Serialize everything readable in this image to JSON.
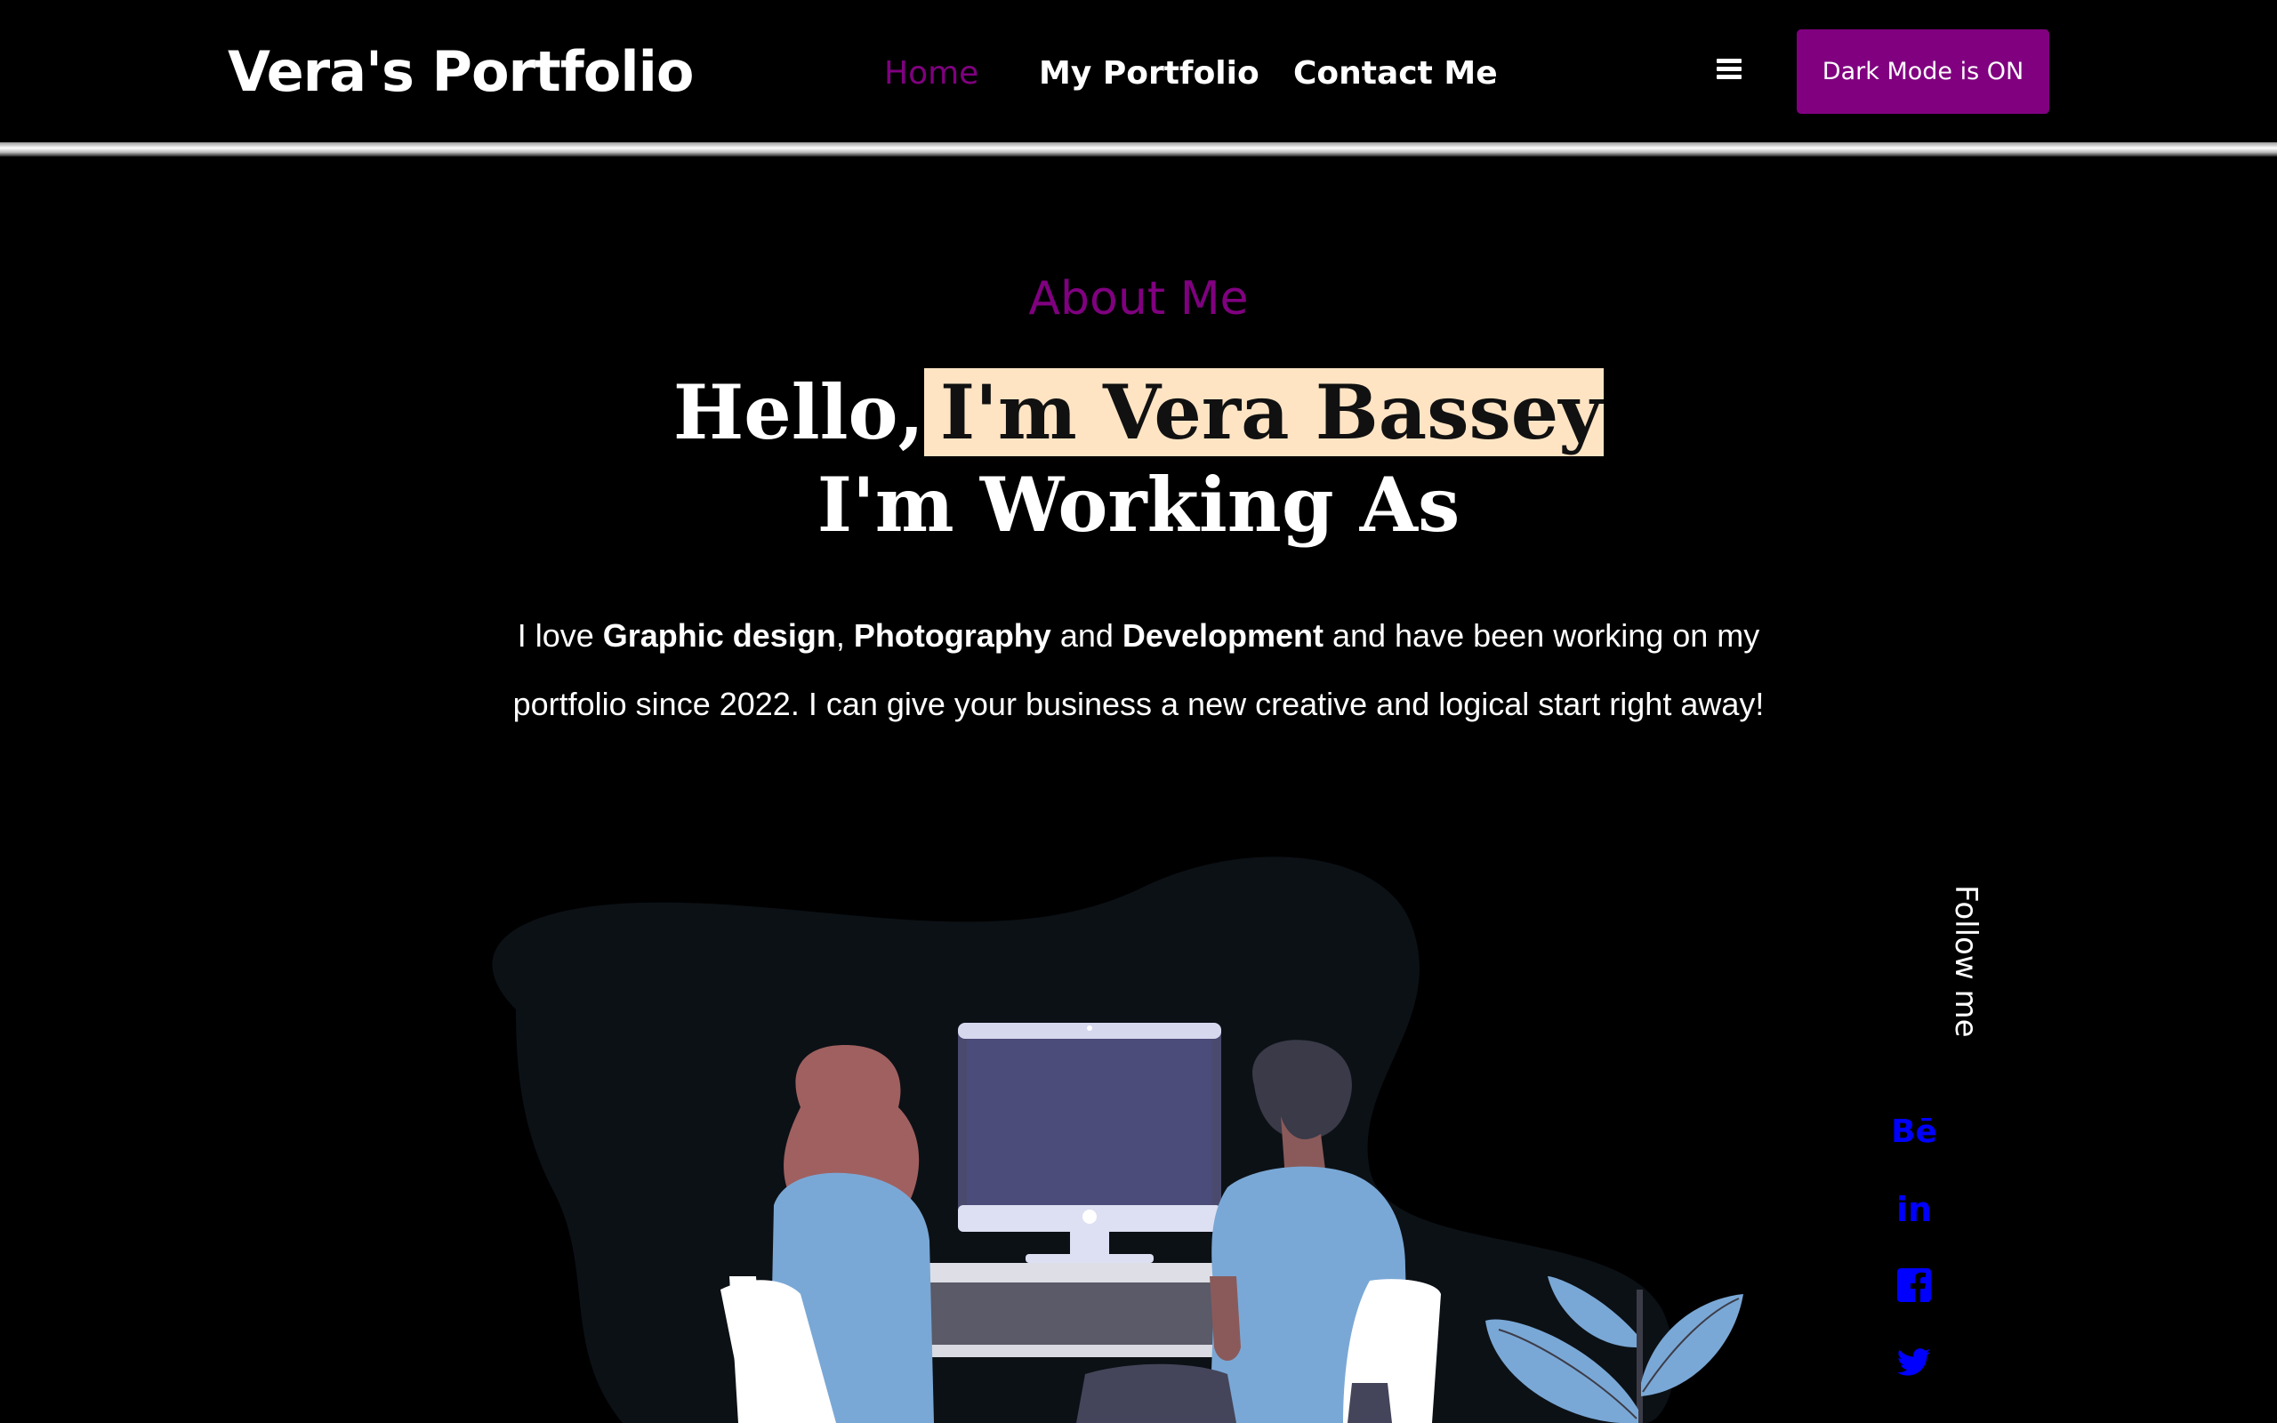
{
  "nav": {
    "logo": "Vera's Portfolio",
    "links": [
      "Home",
      "My Portfolio",
      "Contact Me"
    ],
    "menu_icon": "hamburger-icon",
    "dark_mode_label": "Dark Mode is ON"
  },
  "about": {
    "section_title": "About Me",
    "hero_line1_a": "Hello,",
    "hero_line1_b": "I'm Vera Bassey",
    "hero_line2": "I'm Working As",
    "desc_1": "I love ",
    "desc_b1": "Graphic design",
    "desc_2": ", ",
    "desc_b2": "Photography",
    "desc_3": " and ",
    "desc_b3": "Development",
    "desc_4": " and have been working on my portfolio since 2022. I can give your business a new creative and logical start right away!"
  },
  "social": {
    "follow_label": "Follow me",
    "icons": [
      {
        "name": "behance-icon",
        "glyph": "Bē"
      },
      {
        "name": "linkedin-icon",
        "glyph": "in"
      },
      {
        "name": "facebook-icon",
        "glyph": "f"
      },
      {
        "name": "twitter-icon",
        "glyph": "🐦"
      }
    ]
  },
  "colors": {
    "accent": "#800080",
    "highlight": "#ffe4c4",
    "social": "#0000ff"
  }
}
